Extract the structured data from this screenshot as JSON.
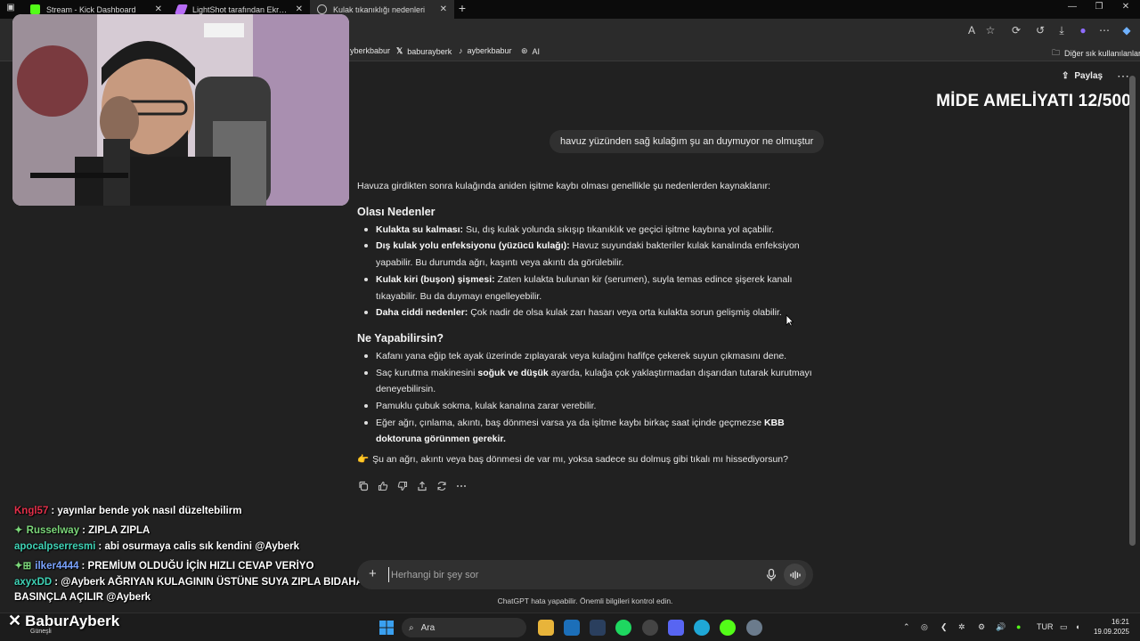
{
  "browser": {
    "tabs": [
      {
        "label": "Stream - Kick Dashboard",
        "active": false,
        "color": "#53fc18"
      },
      {
        "label": "LightShot tarafından Ekran Görün",
        "active": false,
        "color": "#b76cf5"
      },
      {
        "label": "Kulak tıkanıklığı nedenleri",
        "active": true,
        "color": "#bdbdbd"
      }
    ],
    "new_tab": "+",
    "bookmarks": [
      {
        "label": "yberkbabur",
        "icon": "instagram-icon"
      },
      {
        "label": "baburayberk",
        "icon": "x-icon"
      },
      {
        "label": "ayberkbabur",
        "icon": "tiktok-icon"
      },
      {
        "label": "AI",
        "icon": "openai-icon"
      }
    ],
    "other_bookmarks": "Diğer sık kullanılanlar"
  },
  "overlay": {
    "title": "MİDE AMELİYATI 12/500",
    "brand": "BaburAyberk",
    "brand_sub": "Güneşli"
  },
  "chat_messages": [
    {
      "user": "Kngl57",
      "text": ": yayınlar bende yok nasıl düzeltebilirm",
      "color": "#e3304a",
      "badge": ""
    },
    {
      "user": "Russelway",
      "text": ": ZIPLA ZIPLA",
      "color": "#7cd77a",
      "badge": "✦"
    },
    {
      "user": "apocalpserresmi",
      "text": ": abi osurmaya calis sık kendini @Ayberk",
      "color": "#3fd3b6",
      "badge": ""
    },
    {
      "user": "ilker4444",
      "text": ": PREMİUM OLDUĞU İÇİN HIZLI CEVAP VERİYO",
      "color": "#7aa3ff",
      "badge": "✦⊞"
    },
    {
      "user": "axyxDD",
      "text": ": @Ayberk AĞRIYAN KULAGININ ÜSTÜNE SUYA ZIPLA BIDAHA O",
      "color": "#3fd3b6",
      "badge": ""
    },
    {
      "user": "",
      "text": "BASINÇLA AÇILIR @Ayberk",
      "color": "#ffffff",
      "badge": ""
    }
  ],
  "chatgpt": {
    "share_label": "Paylaş",
    "user_message": "havuz yüzünden sağ kulağım şu an duymuyor ne olmuştur",
    "intro": "Havuza girdikten sonra kulağında aniden işitme kaybı olması genellikle şu nedenlerden kaynaklanır:",
    "section1_title": "Olası Nedenler",
    "causes": [
      {
        "bold": "Kulakta su kalması:",
        "text": " Su, dış kulak yolunda sıkışıp tıkanıklık ve geçici işitme kaybına yol açabilir."
      },
      {
        "bold": "Dış kulak yolu enfeksiyonu (yüzücü kulağı):",
        "text": " Havuz suyundaki bakteriler kulak kanalında enfeksiyon yapabilir. Bu durumda ağrı, kaşıntı veya akıntı da görülebilir."
      },
      {
        "bold": "Kulak kiri (buşon) şişmesi:",
        "text": " Zaten kulakta bulunan kir (serumen), suyla temas edince şişerek kanalı tıkayabilir. Bu da duymayı engelleyebilir."
      },
      {
        "bold": "Daha ciddi nedenler:",
        "text": " Çok nadir de olsa kulak zarı hasarı veya orta kulakta sorun gelişmiş olabilir."
      }
    ],
    "section2_title": "Ne Yapabilirsin?",
    "actions_list": [
      {
        "pre": "Kafanı yana eğip tek ayak üzerinde zıplayarak veya kulağını hafifçe çekerek suyun çıkmasını dene.",
        "bold": "",
        "post": ""
      },
      {
        "pre": "Saç kurutma makinesini ",
        "bold": "soğuk ve düşük",
        "post": " ayarda, kulağa çok yaklaştırmadan dışarıdan tutarak kurutmayı deneyebilirsin."
      },
      {
        "pre": "Pamuklu çubuk sokma, kulak kanalına zarar verebilir.",
        "bold": "",
        "post": ""
      },
      {
        "pre": "Eğer ağrı, çınlama, akıntı, baş dönmesi varsa ya da işitme kaybı birkaç saat içinde geçmezse ",
        "bold": "KBB doktoruna görünmen gerekir.",
        "post": ""
      }
    ],
    "closing_emoji": "👉",
    "closing": "Şu an ağrı, akıntı veya baş dönmesi de var mı, yoksa sadece su dolmuş gibi tıkalı mı hissediyorsun?",
    "composer_placeholder": "Herhangi bir şey sor",
    "disclaimer": "ChatGPT hata yapabilir. Önemli bilgileri kontrol edin."
  },
  "taskbar": {
    "search_label": "Ara",
    "language": "TUR",
    "time": "16:21",
    "date": "19.09.2025"
  }
}
